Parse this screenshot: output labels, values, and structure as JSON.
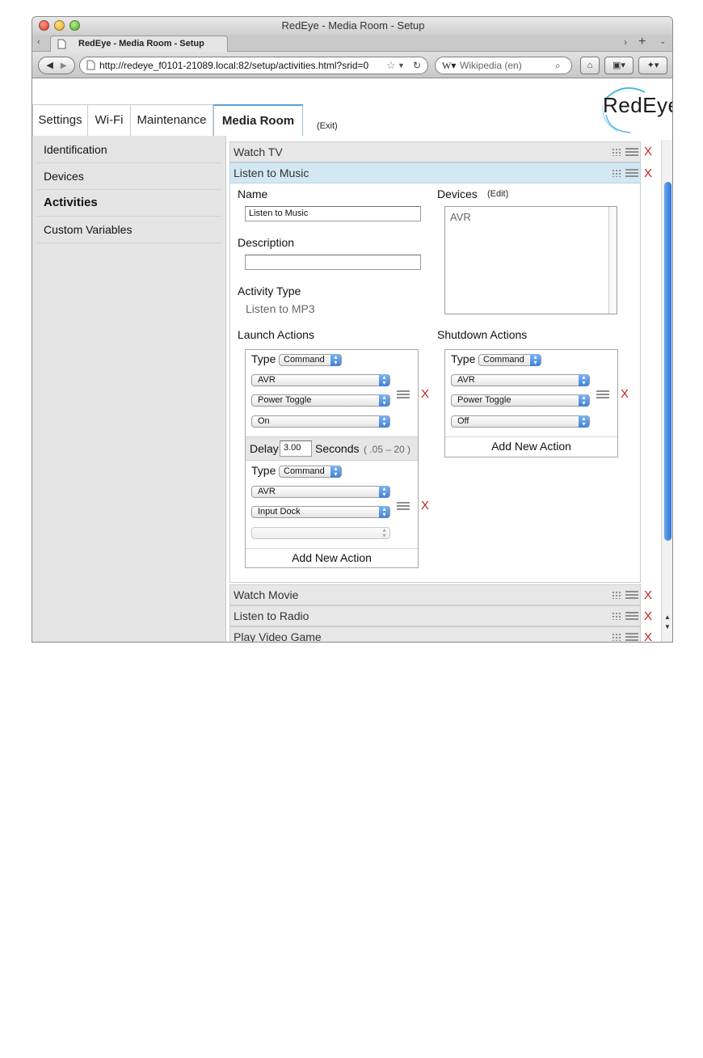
{
  "window": {
    "title": "RedEye - Media Room - Setup",
    "tab_title": "RedEye - Media Room - Setup",
    "url": "http://redeye_f0101-21089.local:82/setup/activities.html?srid=0",
    "search_placeholder": "Wikipedia (en)"
  },
  "top_tabs": [
    {
      "label": "Settings"
    },
    {
      "label": "Wi-Fi"
    },
    {
      "label": "Maintenance"
    },
    {
      "label": "Media Room"
    }
  ],
  "exit_label": "(Exit)",
  "logo_text": "RedEye",
  "sidebar": {
    "items": [
      {
        "label": "Identification"
      },
      {
        "label": "Devices"
      },
      {
        "label": "Activities"
      },
      {
        "label": "Custom Variables"
      }
    ],
    "active": "Activities"
  },
  "activities": [
    {
      "label": "Watch TV"
    },
    {
      "label": "Listen to Music"
    },
    {
      "label": "Watch Movie"
    },
    {
      "label": "Listen to Radio"
    },
    {
      "label": "Play Video Game"
    }
  ],
  "delete_label": "X",
  "detail": {
    "name_label": "Name",
    "name_value": "Listen to Music",
    "description_label": "Description",
    "description_value": "",
    "activity_type_label": "Activity Type",
    "activity_type_value": "Listen to MP3",
    "devices_label": "Devices",
    "devices_edit": "(Edit)",
    "devices_list": [
      "AVR"
    ],
    "launch_label": "Launch Actions",
    "shutdown_label": "Shutdown Actions",
    "type_label": "Type",
    "type_value": "Command",
    "launch_actions": [
      {
        "device": "AVR",
        "command": "Power Toggle",
        "param": "On"
      },
      {
        "device": "AVR",
        "command": "Input Dock",
        "param": ""
      }
    ],
    "delay": {
      "label": "Delay",
      "value": "3.00",
      "unit": "Seconds",
      "range": "( .05 – 20 )"
    },
    "shutdown_actions": [
      {
        "device": "AVR",
        "command": "Power Toggle",
        "param": "Off"
      }
    ],
    "add_new_action": "Add New Action"
  },
  "colors": {
    "active_header_bg": "#d3e8f3",
    "delete_red": "#c0241b",
    "scroll_blue": "#2e74d6"
  }
}
